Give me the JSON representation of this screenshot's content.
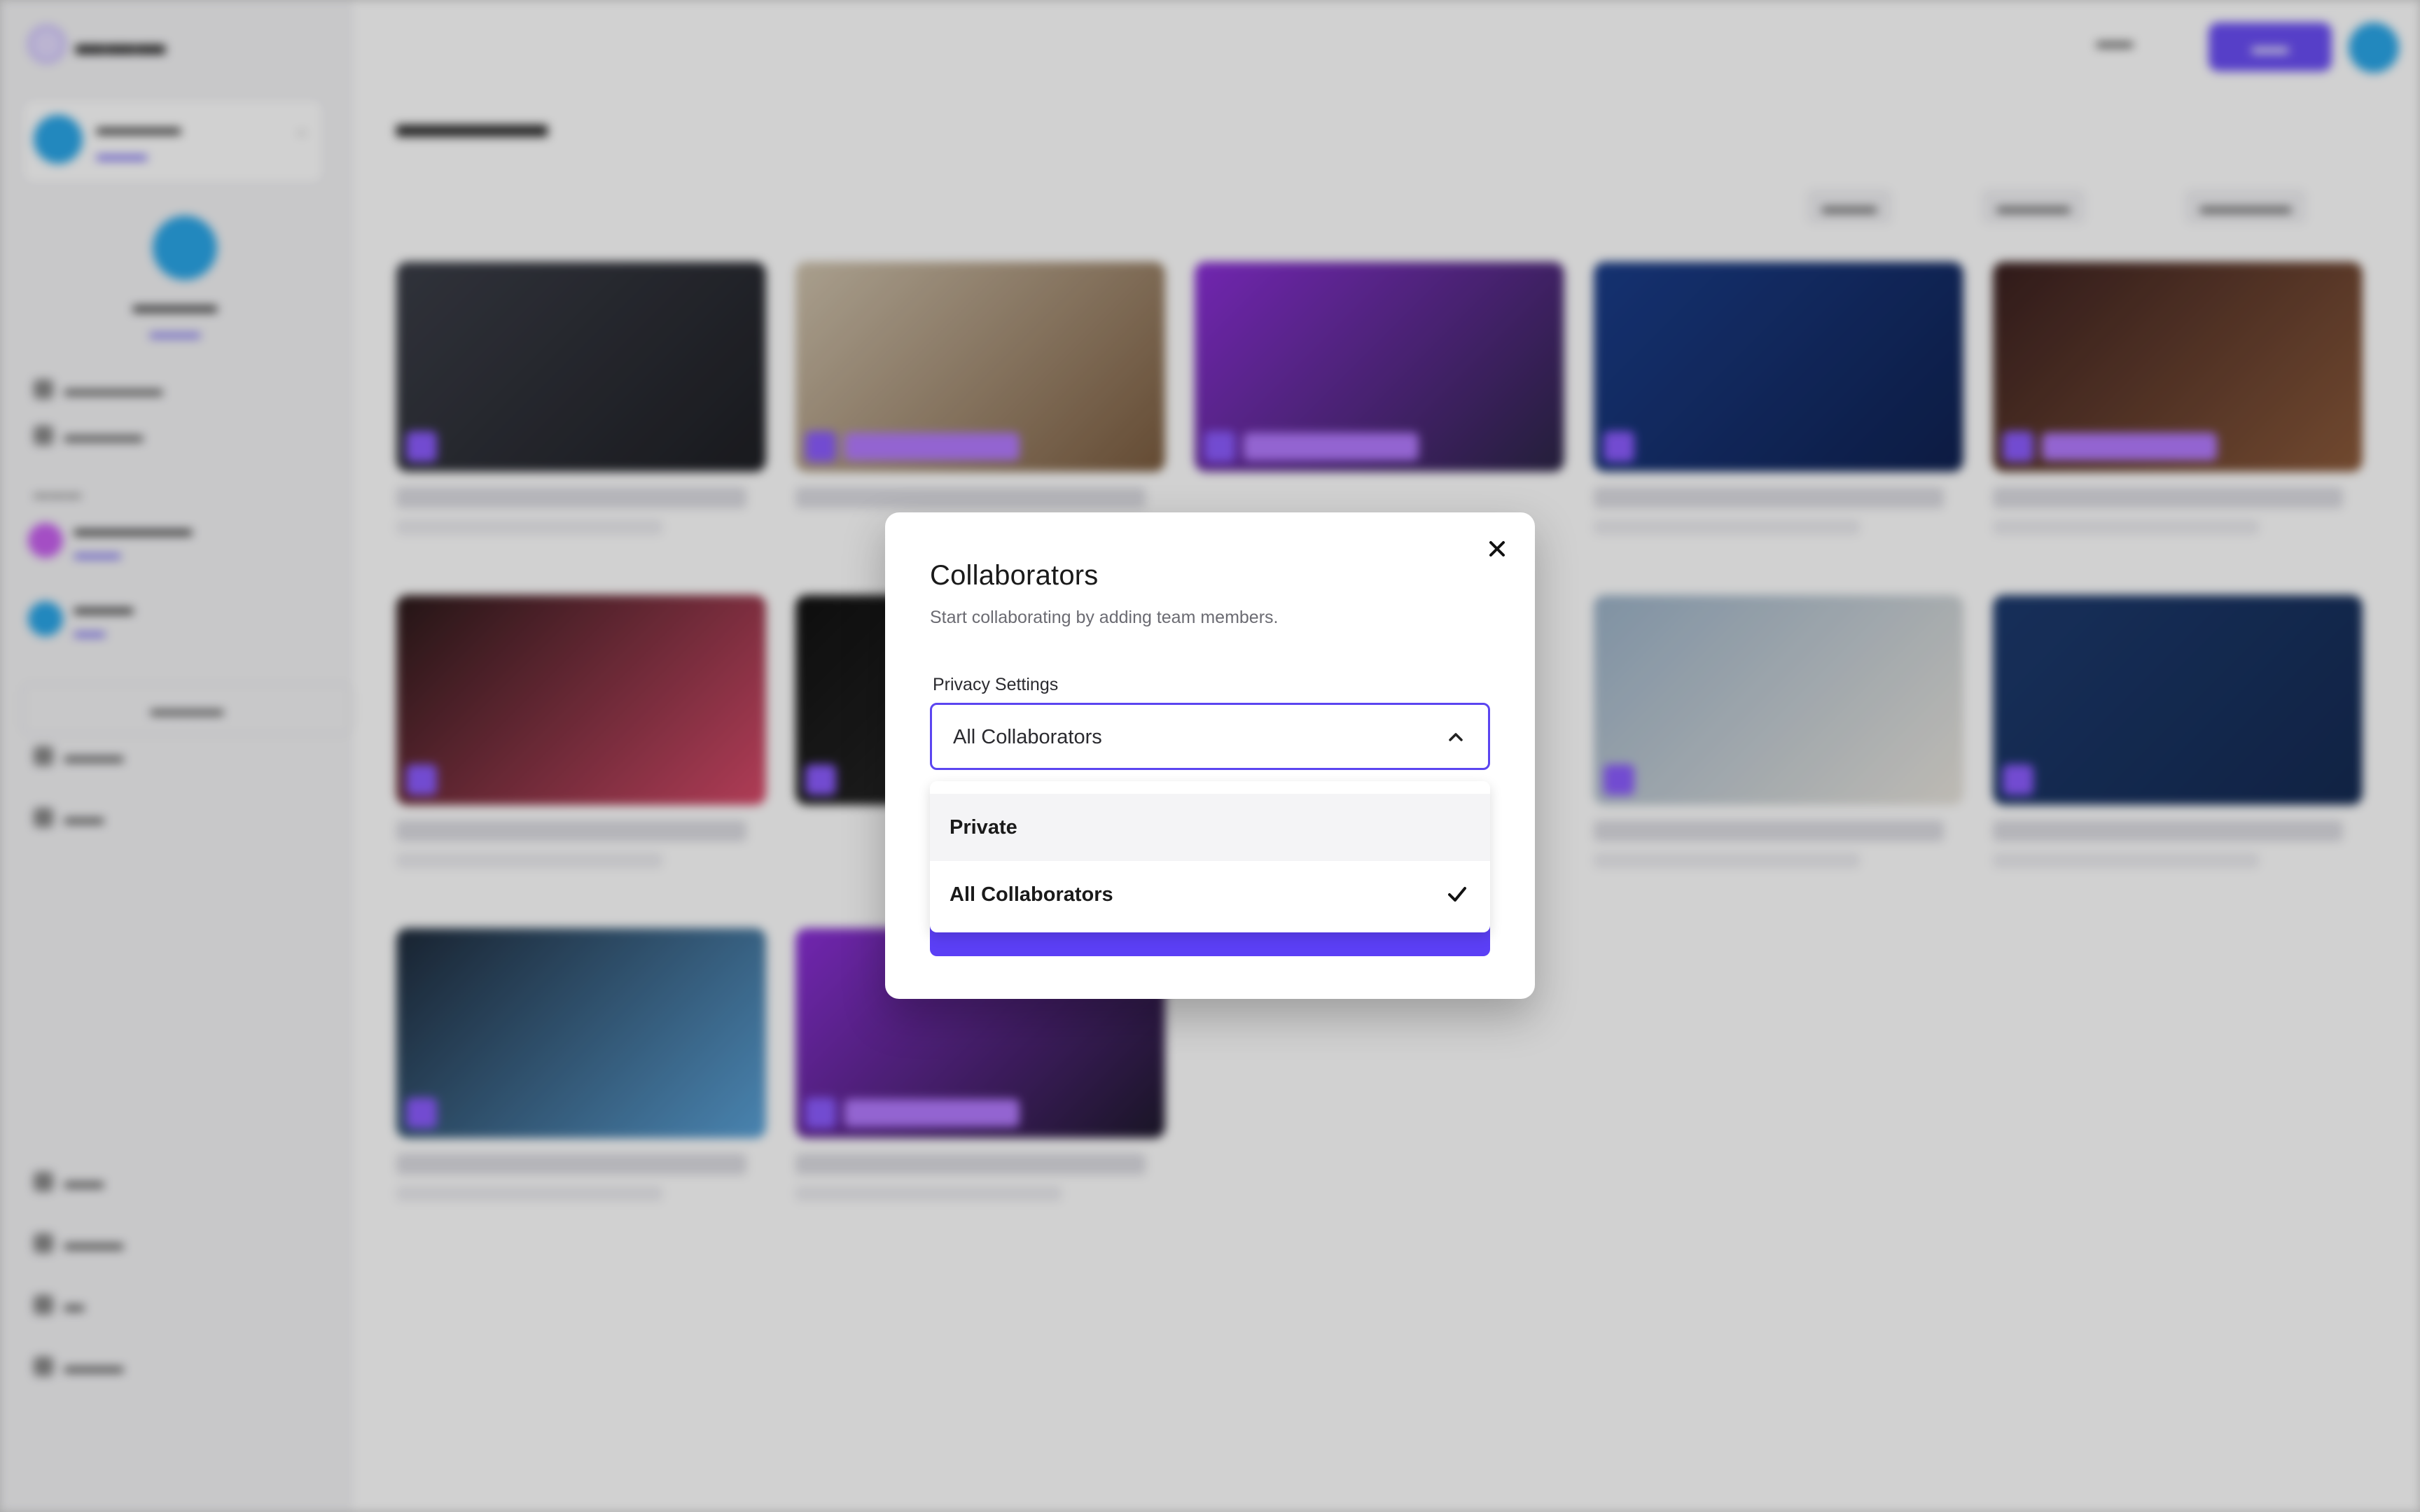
{
  "modal": {
    "title": "Collaborators",
    "subtitle": "Start collaborating by adding team members.",
    "field_label": "Privacy Settings",
    "select_value": "All Collaborators",
    "options": [
      {
        "label": "Private",
        "selected": false
      },
      {
        "label": "All Collaborators",
        "selected": true
      }
    ],
    "icons": {
      "close": "close-icon",
      "chevron": "chevron-up-icon",
      "check": "checkmark-icon"
    },
    "colors": {
      "accent": "#5b45f0",
      "button": "#5b3ff5"
    }
  }
}
